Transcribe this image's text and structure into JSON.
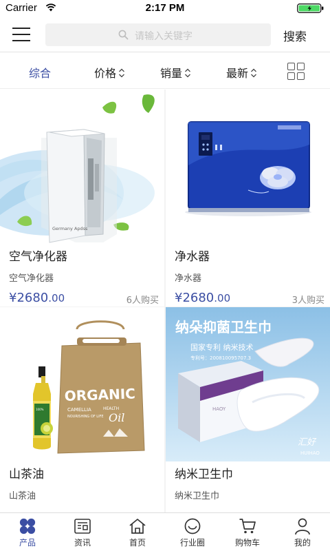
{
  "status_bar": {
    "carrier": "Carrier",
    "time": "2:17 PM"
  },
  "header": {
    "search_placeholder": "请输入关键字",
    "search_button": "搜索"
  },
  "sort_bar": {
    "items": [
      {
        "label": "综合",
        "active": true
      },
      {
        "label": "价格",
        "active": false
      },
      {
        "label": "销量",
        "active": false
      },
      {
        "label": "最新",
        "active": false
      }
    ]
  },
  "products": [
    {
      "name": "空气净化器",
      "subtitle": "空气净化器",
      "price_main": "¥2680",
      "price_decimal": ".00",
      "sold": "6人购买",
      "image_caption": "Germany Apdss"
    },
    {
      "name": "净水器",
      "subtitle": "净水器",
      "price_main": "¥2680",
      "price_decimal": ".00",
      "sold": "3人购买"
    },
    {
      "name": "山茶油",
      "subtitle": "山茶油",
      "image_text": {
        "brand": "ORGANIC",
        "line1": "CAMELLIA",
        "line2": "HEALTH",
        "line3": "NOURISHING OF LIFE",
        "oil": "Oil"
      }
    },
    {
      "name": "纳米卫生巾",
      "subtitle": "纳米卫生巾",
      "image_text": {
        "headline": "纳朵抑菌卫生巾",
        "tagline": "国家专利  纳米技术",
        "patent": "专利号：200810095707.3",
        "brand": "汇好",
        "brand_en": "HUIHAO"
      }
    }
  ],
  "tabbar": {
    "items": [
      {
        "label": "产品",
        "icon": "products-icon",
        "active": true
      },
      {
        "label": "资讯",
        "icon": "news-icon",
        "active": false
      },
      {
        "label": "首页",
        "icon": "home-icon",
        "active": false
      },
      {
        "label": "行业圈",
        "icon": "community-icon",
        "active": false
      },
      {
        "label": "购物车",
        "icon": "cart-icon",
        "active": false
      },
      {
        "label": "我的",
        "icon": "profile-icon",
        "active": false
      }
    ]
  },
  "colors": {
    "accent": "#3b4ea3",
    "battery": "#4cd964"
  }
}
